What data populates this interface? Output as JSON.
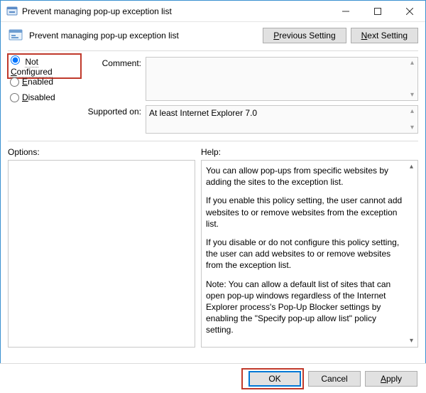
{
  "window": {
    "title": "Prevent managing pop-up exception list"
  },
  "header": {
    "title": "Prevent managing pop-up exception list",
    "previous": "Previous Setting",
    "next": "Next Setting"
  },
  "radios": {
    "not_configured": "Not Configured",
    "enabled": "Enabled",
    "disabled": "Disabled",
    "selected": "not_configured"
  },
  "fields": {
    "comment_label": "Comment:",
    "comment_value": "",
    "supported_label": "Supported on:",
    "supported_value": "At least Internet Explorer 7.0"
  },
  "lower": {
    "options_label": "Options:",
    "help_label": "Help:",
    "help_paragraphs": [
      "You can allow pop-ups from specific websites by adding the sites to the exception list.",
      "If you enable this policy setting, the user cannot add websites to or remove websites from the exception list.",
      "If you disable or do not configure this policy setting, the user can add websites to or remove websites from the exception list.",
      "Note: You can allow a default list of sites that can open pop-up windows regardless of the Internet Explorer process's Pop-Up Blocker settings by enabling the \"Specify pop-up allow list\" policy setting."
    ]
  },
  "footer": {
    "ok": "OK",
    "cancel": "Cancel",
    "apply": "Apply"
  }
}
